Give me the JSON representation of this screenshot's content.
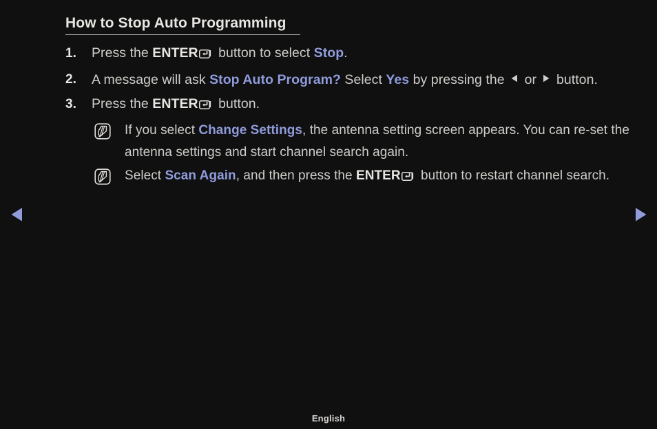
{
  "colors": {
    "background": "#101010",
    "body_text": "#cfcdc9",
    "strong_text": "#e8e6e2",
    "accent_blue": "#8f9bdb",
    "rule": "#bdbbb7"
  },
  "header": {
    "title": "How to Stop Auto Programming"
  },
  "steps": [
    {
      "number": "1.",
      "segments": [
        {
          "type": "text",
          "value": "Press the "
        },
        {
          "type": "strong",
          "value": "ENTER"
        },
        {
          "type": "icon",
          "value": "enter-key-icon"
        },
        {
          "type": "text",
          "value": " button to select "
        },
        {
          "type": "accent",
          "value": "Stop"
        },
        {
          "type": "text",
          "value": "."
        }
      ]
    },
    {
      "number": "2.",
      "segments": [
        {
          "type": "text",
          "value": "A message will ask "
        },
        {
          "type": "accent",
          "value": "Stop Auto Program?"
        },
        {
          "type": "text",
          "value": " Select "
        },
        {
          "type": "accent",
          "value": "Yes"
        },
        {
          "type": "text",
          "value": " by pressing the "
        },
        {
          "type": "icon",
          "value": "triangle-left-icon"
        },
        {
          "type": "text",
          "value": " or "
        },
        {
          "type": "icon",
          "value": "triangle-right-icon"
        },
        {
          "type": "text",
          "value": " button."
        }
      ]
    },
    {
      "number": "3.",
      "segments": [
        {
          "type": "text",
          "value": "Press the "
        },
        {
          "type": "strong",
          "value": "ENTER"
        },
        {
          "type": "icon",
          "value": "enter-key-icon"
        },
        {
          "type": "text",
          "value": " button."
        }
      ]
    }
  ],
  "notes": [
    {
      "icon": "note-icon",
      "segments": [
        {
          "type": "text",
          "value": "If you select "
        },
        {
          "type": "accent",
          "value": "Change Settings"
        },
        {
          "type": "text",
          "value": ", the antenna setting screen appears. You can re-set the antenna settings and start channel search again."
        }
      ]
    },
    {
      "icon": "note-icon",
      "segments": [
        {
          "type": "text",
          "value": "Select "
        },
        {
          "type": "accent",
          "value": "Scan Again"
        },
        {
          "type": "text",
          "value": ", and then press the "
        },
        {
          "type": "strong",
          "value": "ENTER"
        },
        {
          "type": "icon",
          "value": "enter-key-icon"
        },
        {
          "type": "text",
          "value": " button to restart channel search."
        }
      ]
    }
  ],
  "navigation": {
    "previous_page_icon": "triangle-left-icon",
    "next_page_icon": "triangle-right-icon"
  },
  "footer": {
    "language": "English"
  }
}
